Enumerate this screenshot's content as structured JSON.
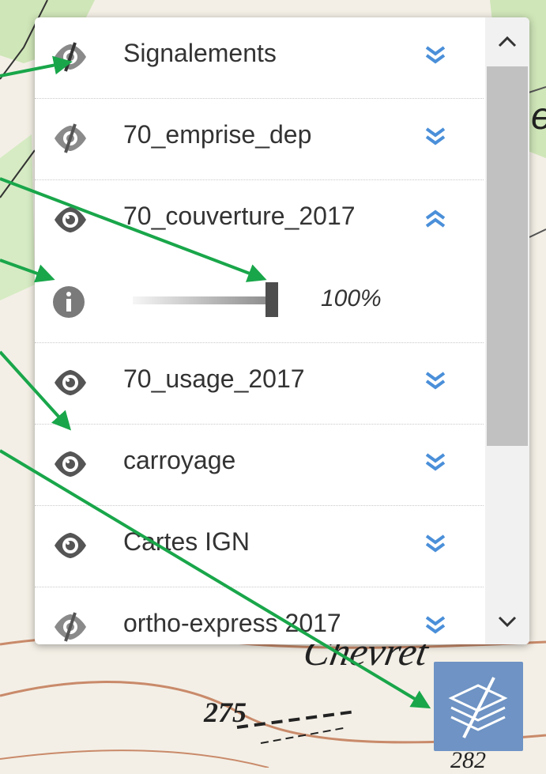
{
  "layers": [
    {
      "name": "Signalements",
      "visible": false,
      "expanded": false
    },
    {
      "name": "70_emprise_dep",
      "visible": false,
      "expanded": false
    },
    {
      "name": "70_couverture_2017",
      "visible": true,
      "expanded": true
    },
    {
      "name": "70_usage_2017",
      "visible": true,
      "expanded": false
    },
    {
      "name": "carroyage",
      "visible": true,
      "expanded": false
    },
    {
      "name": "Cartes IGN",
      "visible": true,
      "expanded": false
    },
    {
      "name": "ortho-express 2017",
      "visible": false,
      "expanded": false
    }
  ],
  "detail": {
    "opacity_label": "100%",
    "opacity": 100
  },
  "map_labels": {
    "elevation_a": "275",
    "elevation_b": "282",
    "place": "Chevret",
    "edge_letter": "e"
  },
  "colors": {
    "chevron_blue": "#4a8fd9",
    "arrow_green": "#19a64a",
    "layers_button": "#6e93c4",
    "icon_gray": "#7a7a7a"
  },
  "icons": {
    "visible": "eye-icon",
    "hidden": "eye-slash-icon",
    "expand": "double-chevron-down-icon",
    "collapse": "double-chevron-up-icon",
    "info": "info-circle-icon",
    "layers": "layers-stack-icon"
  }
}
